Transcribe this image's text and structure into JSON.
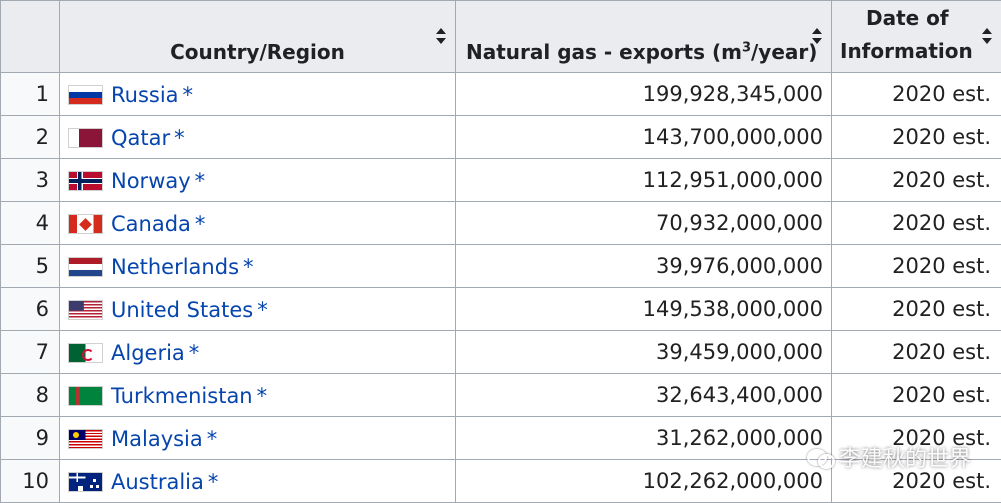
{
  "table": {
    "headers": {
      "rank": "",
      "country": "Country/Region",
      "exports_prefix": "Natural gas - exports (m",
      "exports_sup": "3",
      "exports_suffix": "/year)",
      "date_line1": "Date of",
      "date_line2": "Information"
    },
    "rows": [
      {
        "rank": "1",
        "flag": "russia",
        "country": "Russia",
        "marker": "*",
        "exports": "199,928,345,000",
        "date": "2020 est."
      },
      {
        "rank": "2",
        "flag": "qatar",
        "country": "Qatar",
        "marker": "*",
        "exports": "143,700,000,000",
        "date": "2020 est."
      },
      {
        "rank": "3",
        "flag": "norway",
        "country": "Norway",
        "marker": "*",
        "exports": "112,951,000,000",
        "date": "2020 est."
      },
      {
        "rank": "4",
        "flag": "canada",
        "country": "Canada",
        "marker": "*",
        "exports": "70,932,000,000",
        "date": "2020 est."
      },
      {
        "rank": "5",
        "flag": "netherlands",
        "country": "Netherlands",
        "marker": "*",
        "exports": "39,976,000,000",
        "date": "2020 est."
      },
      {
        "rank": "6",
        "flag": "us",
        "country": "United States",
        "marker": "*",
        "exports": "149,538,000,000",
        "date": "2020 est."
      },
      {
        "rank": "7",
        "flag": "algeria",
        "country": "Algeria",
        "marker": "*",
        "exports": "39,459,000,000",
        "date": "2020 est."
      },
      {
        "rank": "8",
        "flag": "turkmenistan",
        "country": "Turkmenistan",
        "marker": "*",
        "exports": "32,643,400,000",
        "date": "2020 est."
      },
      {
        "rank": "9",
        "flag": "malaysia",
        "country": "Malaysia",
        "marker": "*",
        "exports": "31,262,000,000",
        "date": "2020 est."
      },
      {
        "rank": "10",
        "flag": "australia",
        "country": "Australia",
        "marker": "*",
        "exports": "102,262,000,000",
        "date": "2020 est."
      }
    ]
  },
  "watermark": {
    "icon": "wechat-icon",
    "text": "李建秋的世界"
  },
  "colors": {
    "link": "#0645ad",
    "header_bg": "#eaecf0",
    "border": "#a2a9b1",
    "text": "#202122"
  }
}
